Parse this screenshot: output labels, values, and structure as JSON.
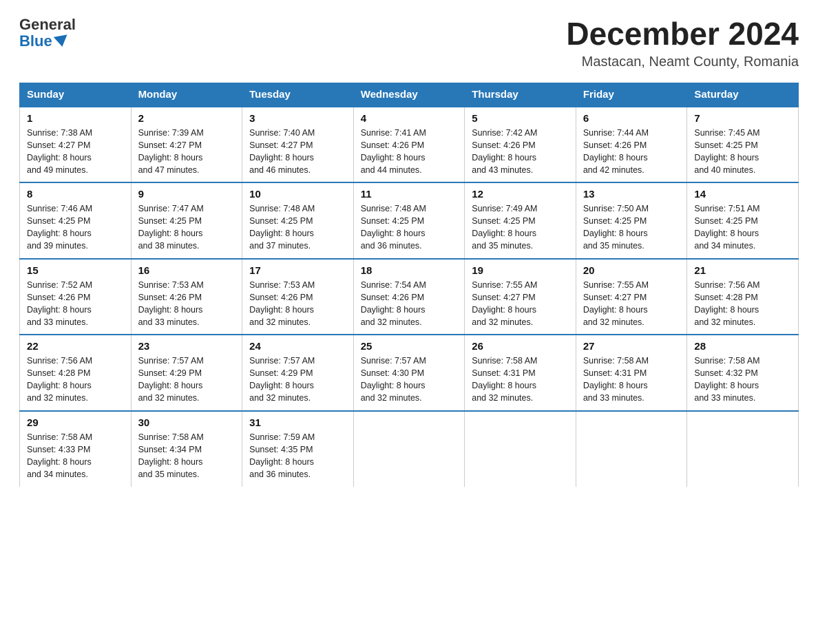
{
  "logo": {
    "general": "General",
    "blue": "Blue"
  },
  "title": "December 2024",
  "subtitle": "Mastacan, Neamt County, Romania",
  "headers": [
    "Sunday",
    "Monday",
    "Tuesday",
    "Wednesday",
    "Thursday",
    "Friday",
    "Saturday"
  ],
  "weeks": [
    [
      {
        "day": "1",
        "sunrise": "7:38 AM",
        "sunset": "4:27 PM",
        "daylight": "8 hours and 49 minutes."
      },
      {
        "day": "2",
        "sunrise": "7:39 AM",
        "sunset": "4:27 PM",
        "daylight": "8 hours and 47 minutes."
      },
      {
        "day": "3",
        "sunrise": "7:40 AM",
        "sunset": "4:27 PM",
        "daylight": "8 hours and 46 minutes."
      },
      {
        "day": "4",
        "sunrise": "7:41 AM",
        "sunset": "4:26 PM",
        "daylight": "8 hours and 44 minutes."
      },
      {
        "day": "5",
        "sunrise": "7:42 AM",
        "sunset": "4:26 PM",
        "daylight": "8 hours and 43 minutes."
      },
      {
        "day": "6",
        "sunrise": "7:44 AM",
        "sunset": "4:26 PM",
        "daylight": "8 hours and 42 minutes."
      },
      {
        "day": "7",
        "sunrise": "7:45 AM",
        "sunset": "4:25 PM",
        "daylight": "8 hours and 40 minutes."
      }
    ],
    [
      {
        "day": "8",
        "sunrise": "7:46 AM",
        "sunset": "4:25 PM",
        "daylight": "8 hours and 39 minutes."
      },
      {
        "day": "9",
        "sunrise": "7:47 AM",
        "sunset": "4:25 PM",
        "daylight": "8 hours and 38 minutes."
      },
      {
        "day": "10",
        "sunrise": "7:48 AM",
        "sunset": "4:25 PM",
        "daylight": "8 hours and 37 minutes."
      },
      {
        "day": "11",
        "sunrise": "7:48 AM",
        "sunset": "4:25 PM",
        "daylight": "8 hours and 36 minutes."
      },
      {
        "day": "12",
        "sunrise": "7:49 AM",
        "sunset": "4:25 PM",
        "daylight": "8 hours and 35 minutes."
      },
      {
        "day": "13",
        "sunrise": "7:50 AM",
        "sunset": "4:25 PM",
        "daylight": "8 hours and 35 minutes."
      },
      {
        "day": "14",
        "sunrise": "7:51 AM",
        "sunset": "4:25 PM",
        "daylight": "8 hours and 34 minutes."
      }
    ],
    [
      {
        "day": "15",
        "sunrise": "7:52 AM",
        "sunset": "4:26 PM",
        "daylight": "8 hours and 33 minutes."
      },
      {
        "day": "16",
        "sunrise": "7:53 AM",
        "sunset": "4:26 PM",
        "daylight": "8 hours and 33 minutes."
      },
      {
        "day": "17",
        "sunrise": "7:53 AM",
        "sunset": "4:26 PM",
        "daylight": "8 hours and 32 minutes."
      },
      {
        "day": "18",
        "sunrise": "7:54 AM",
        "sunset": "4:26 PM",
        "daylight": "8 hours and 32 minutes."
      },
      {
        "day": "19",
        "sunrise": "7:55 AM",
        "sunset": "4:27 PM",
        "daylight": "8 hours and 32 minutes."
      },
      {
        "day": "20",
        "sunrise": "7:55 AM",
        "sunset": "4:27 PM",
        "daylight": "8 hours and 32 minutes."
      },
      {
        "day": "21",
        "sunrise": "7:56 AM",
        "sunset": "4:28 PM",
        "daylight": "8 hours and 32 minutes."
      }
    ],
    [
      {
        "day": "22",
        "sunrise": "7:56 AM",
        "sunset": "4:28 PM",
        "daylight": "8 hours and 32 minutes."
      },
      {
        "day": "23",
        "sunrise": "7:57 AM",
        "sunset": "4:29 PM",
        "daylight": "8 hours and 32 minutes."
      },
      {
        "day": "24",
        "sunrise": "7:57 AM",
        "sunset": "4:29 PM",
        "daylight": "8 hours and 32 minutes."
      },
      {
        "day": "25",
        "sunrise": "7:57 AM",
        "sunset": "4:30 PM",
        "daylight": "8 hours and 32 minutes."
      },
      {
        "day": "26",
        "sunrise": "7:58 AM",
        "sunset": "4:31 PM",
        "daylight": "8 hours and 32 minutes."
      },
      {
        "day": "27",
        "sunrise": "7:58 AM",
        "sunset": "4:31 PM",
        "daylight": "8 hours and 33 minutes."
      },
      {
        "day": "28",
        "sunrise": "7:58 AM",
        "sunset": "4:32 PM",
        "daylight": "8 hours and 33 minutes."
      }
    ],
    [
      {
        "day": "29",
        "sunrise": "7:58 AM",
        "sunset": "4:33 PM",
        "daylight": "8 hours and 34 minutes."
      },
      {
        "day": "30",
        "sunrise": "7:58 AM",
        "sunset": "4:34 PM",
        "daylight": "8 hours and 35 minutes."
      },
      {
        "day": "31",
        "sunrise": "7:59 AM",
        "sunset": "4:35 PM",
        "daylight": "8 hours and 36 minutes."
      },
      null,
      null,
      null,
      null
    ]
  ],
  "labels": {
    "sunrise": "Sunrise:",
    "sunset": "Sunset:",
    "daylight": "Daylight:"
  }
}
